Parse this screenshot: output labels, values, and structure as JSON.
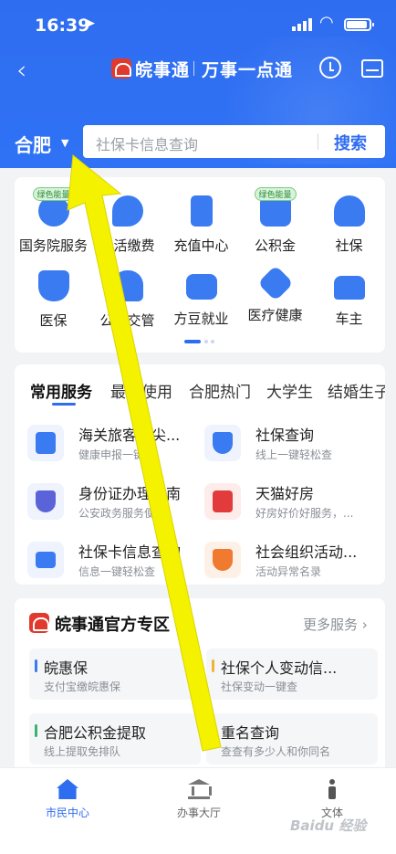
{
  "status_bar": {
    "time": "16:39"
  },
  "header": {
    "app_name": "皖事通",
    "slogan": "万事一点通",
    "city": "合肥"
  },
  "search": {
    "placeholder": "社保卡信息查询",
    "button": "搜索"
  },
  "quick_services": [
    {
      "label": "国务院服务",
      "badge": "绿色能量"
    },
    {
      "label": "生活缴费"
    },
    {
      "label": "充值中心"
    },
    {
      "label": "公积金",
      "badge": "绿色能量"
    },
    {
      "label": "社保"
    },
    {
      "label": "医保"
    },
    {
      "label": "公安交管"
    },
    {
      "label": "方豆就业"
    },
    {
      "label": "医疗健康"
    },
    {
      "label": "车主"
    }
  ],
  "service_tabs": [
    "常用服务",
    "最近使用",
    "合肥热门",
    "大学生",
    "结婚生子"
  ],
  "service_items": [
    {
      "title": "海关旅客指尖...",
      "sub": "健康申报一键填"
    },
    {
      "title": "社保查询",
      "sub": "线上一键轻松查"
    },
    {
      "title": "身份证办理指南",
      "sub": "公安政务服务便民"
    },
    {
      "title": "天猫好房",
      "sub": "好房好价好服务，..."
    },
    {
      "title": "社保卡信息查询",
      "sub": "信息一键轻松查"
    },
    {
      "title": "社会组织活动...",
      "sub": "活动异常名录"
    }
  ],
  "official": {
    "title": "皖事通官方专区",
    "more": "更多服务 ›",
    "tiles": [
      {
        "title": "皖惠保",
        "sub": "支付宝缴皖惠保",
        "color": "#3a7bf2"
      },
      {
        "title": "社保个人变动信...",
        "sub": "社保变动一键查",
        "color": "#f0b23a"
      },
      {
        "title": "合肥公积金提取",
        "sub": "线上提取免排队",
        "color": "#3cb371"
      },
      {
        "title": "重名查询",
        "sub": "查查有多少人和你同名",
        "color": "#3a7bf2"
      }
    ]
  },
  "bottom_nav": [
    "市民中心",
    "办事大厅",
    "文体"
  ],
  "watermark": "Baidu 经验",
  "colors": {
    "primary": "#2f6df0",
    "arrow": "#f5f200",
    "logo_red": "#e03a2f"
  }
}
